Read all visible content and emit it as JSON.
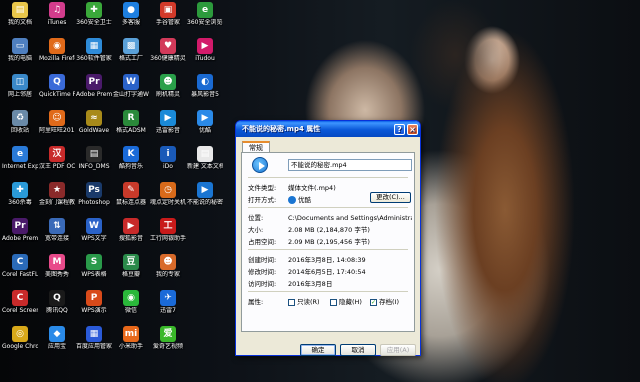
{
  "desktop": {
    "icons": [
      {
        "label": "我的文档",
        "glyph": "▤",
        "color": "#e9c64a"
      },
      {
        "label": "iTunes",
        "glyph": "♫",
        "color": "#d23c8c"
      },
      {
        "label": "360安全卫士",
        "glyph": "✚",
        "color": "#3aa83a"
      },
      {
        "label": "多客服",
        "glyph": "●",
        "color": "#1d7fe0"
      },
      {
        "label": "手谷管家",
        "glyph": "▣",
        "color": "#d23a2a"
      },
      {
        "label": "360安全浏览器",
        "glyph": "e",
        "color": "#2c9a3c"
      },
      {
        "label": "我的电脑",
        "glyph": "▭",
        "color": "#4f7fbf"
      },
      {
        "label": "Mozilla Firefox",
        "glyph": "◉",
        "color": "#e06a1a"
      },
      {
        "label": "360软件管家",
        "glyph": "▦",
        "color": "#2e8bd8"
      },
      {
        "label": "格式工厂",
        "glyph": "▩",
        "color": "#5aa0d8"
      },
      {
        "label": "360健康精灵",
        "glyph": "♥",
        "color": "#d23a5a"
      },
      {
        "label": "iTudou",
        "glyph": "▶",
        "color": "#d21a6a"
      },
      {
        "label": "网上邻居",
        "glyph": "◫",
        "color": "#3a88c8"
      },
      {
        "label": "QuickTime Player",
        "glyph": "Q",
        "color": "#3a6ad8"
      },
      {
        "label": "Adobe Premi...",
        "glyph": "Pr",
        "color": "#4a1a6a"
      },
      {
        "label": "金山打字通Word",
        "glyph": "W",
        "color": "#2a62c8"
      },
      {
        "label": "刷机精灵",
        "glyph": "☻",
        "color": "#2aa04a"
      },
      {
        "label": "暴风影音5",
        "glyph": "◐",
        "color": "#1a6ad2"
      },
      {
        "label": "回收站",
        "glyph": "♻",
        "color": "#6a8aa8"
      },
      {
        "label": "阿里旺旺2015",
        "glyph": "☺",
        "color": "#e06a1a"
      },
      {
        "label": "GoldWave",
        "glyph": "≈",
        "color": "#a88a1a"
      },
      {
        "label": "格式ADSM",
        "glyph": "R",
        "color": "#2a8a3a"
      },
      {
        "label": "迅雷影音",
        "glyph": "▶",
        "color": "#1a8ad8"
      },
      {
        "label": "优酷",
        "glyph": "▶",
        "color": "#2a8ae8"
      },
      {
        "label": "Internet Explorer",
        "glyph": "e",
        "color": "#2a7ad8"
      },
      {
        "label": "汉王 PDF OCR",
        "glyph": "汉",
        "color": "#c82a2a"
      },
      {
        "label": "INFO_DMS",
        "glyph": "▤",
        "color": "#2a2a2a"
      },
      {
        "label": "酷狗音乐",
        "glyph": "K",
        "color": "#1a6ad8"
      },
      {
        "label": "iDo",
        "glyph": "i",
        "color": "#1a5ab8"
      },
      {
        "label": "新建 文本文档.txt",
        "glyph": "▤",
        "color": "#e8e8e8"
      },
      {
        "label": "360杀毒",
        "glyph": "✚",
        "color": "#2a9ad8"
      },
      {
        "label": "金刻门课程教授系统",
        "glyph": "★",
        "color": "#8a2a2a"
      },
      {
        "label": "Photoshop",
        "glyph": "Ps",
        "color": "#1a3a6a"
      },
      {
        "label": "鼠标连点器",
        "glyph": "✎",
        "color": "#c83a2a"
      },
      {
        "label": "魂点定时关机",
        "glyph": "◷",
        "color": "#d86a1a"
      },
      {
        "label": "不能说的秘密.mp4",
        "glyph": "▶",
        "color": "#1a75d2"
      },
      {
        "label": "Adobe Premi...",
        "glyph": "Pr",
        "color": "#4a1a6a"
      },
      {
        "label": "宽带连接",
        "glyph": "⇅",
        "color": "#3a6ab8"
      },
      {
        "label": "WPS文字",
        "glyph": "W",
        "color": "#2a62c8"
      },
      {
        "label": "搜狐影音",
        "glyph": "▶",
        "color": "#c82a2a"
      },
      {
        "label": "工行网银助手",
        "glyph": "工",
        "color": "#c81a1a"
      },
      {
        "label": "",
        "glyph": "",
        "color": "transparent"
      },
      {
        "label": "Corel FastFL...",
        "glyph": "C",
        "color": "#2a6ab8"
      },
      {
        "label": "美图秀秀",
        "glyph": "M",
        "color": "#e84a8a"
      },
      {
        "label": "WPS表格",
        "glyph": "S",
        "color": "#2a9a4a"
      },
      {
        "label": "格豆瓣",
        "glyph": "豆",
        "color": "#2a8a4a"
      },
      {
        "label": "我的专家",
        "glyph": "☻",
        "color": "#d86a2a"
      },
      {
        "label": "",
        "glyph": "",
        "color": "transparent"
      },
      {
        "label": "Corel Screen...",
        "glyph": "C",
        "color": "#c82a2a"
      },
      {
        "label": "腾讯QQ",
        "glyph": "Q",
        "color": "#1a1a1a"
      },
      {
        "label": "WPS演示",
        "glyph": "P",
        "color": "#d84a1a"
      },
      {
        "label": "微信",
        "glyph": "◉",
        "color": "#2ab83a"
      },
      {
        "label": "迅雷7",
        "glyph": "✈",
        "color": "#1a6ad8"
      },
      {
        "label": "",
        "glyph": "",
        "color": "transparent"
      },
      {
        "label": "Google Chrome",
        "glyph": "◎",
        "color": "#d8a81a"
      },
      {
        "label": "应用宝",
        "glyph": "◆",
        "color": "#2a8ae8"
      },
      {
        "label": "百度应用管家",
        "glyph": "▦",
        "color": "#2a5ad8"
      },
      {
        "label": "小米助手",
        "glyph": "mi",
        "color": "#e8681a"
      },
      {
        "label": "爱奇艺视频",
        "glyph": "爱",
        "color": "#3ab82a"
      },
      {
        "label": "",
        "glyph": "",
        "color": "transparent"
      }
    ]
  },
  "window": {
    "title": "不能说的秘密.mp4 属性",
    "help_button": "?",
    "close_button": "×",
    "tab_general": "常规",
    "filename": "不能说的秘密.mp4",
    "labels": {
      "file_type": "文件类型:",
      "open_with": "打开方式:",
      "location": "位置:",
      "size": "大小:",
      "size_on_disk": "占用空间:",
      "created": "创建时间:",
      "modified": "修改时间:",
      "accessed": "访问时间:",
      "attributes": "属性:"
    },
    "values": {
      "file_type": "媒体文件(.mp4)",
      "open_with": "优酷",
      "location": "C:\\Documents and Settings\\Administrator\\桌",
      "size": "2.08 MB (2,184,870 字节)",
      "size_on_disk": "2.09 MB (2,195,456 字节)",
      "created": "2016年3月8日, 14:08:39",
      "modified": "2014年6月5日, 17:40:54",
      "accessed": "2016年3月8日"
    },
    "change_button": "更改(C)...",
    "attr_readonly": "只读(R)",
    "attr_hidden": "隐藏(H)",
    "attr_archive": "存档(I)",
    "archive_checked": "✓",
    "ok_button": "确定",
    "cancel_button": "取消",
    "apply_button": "应用(A)"
  }
}
